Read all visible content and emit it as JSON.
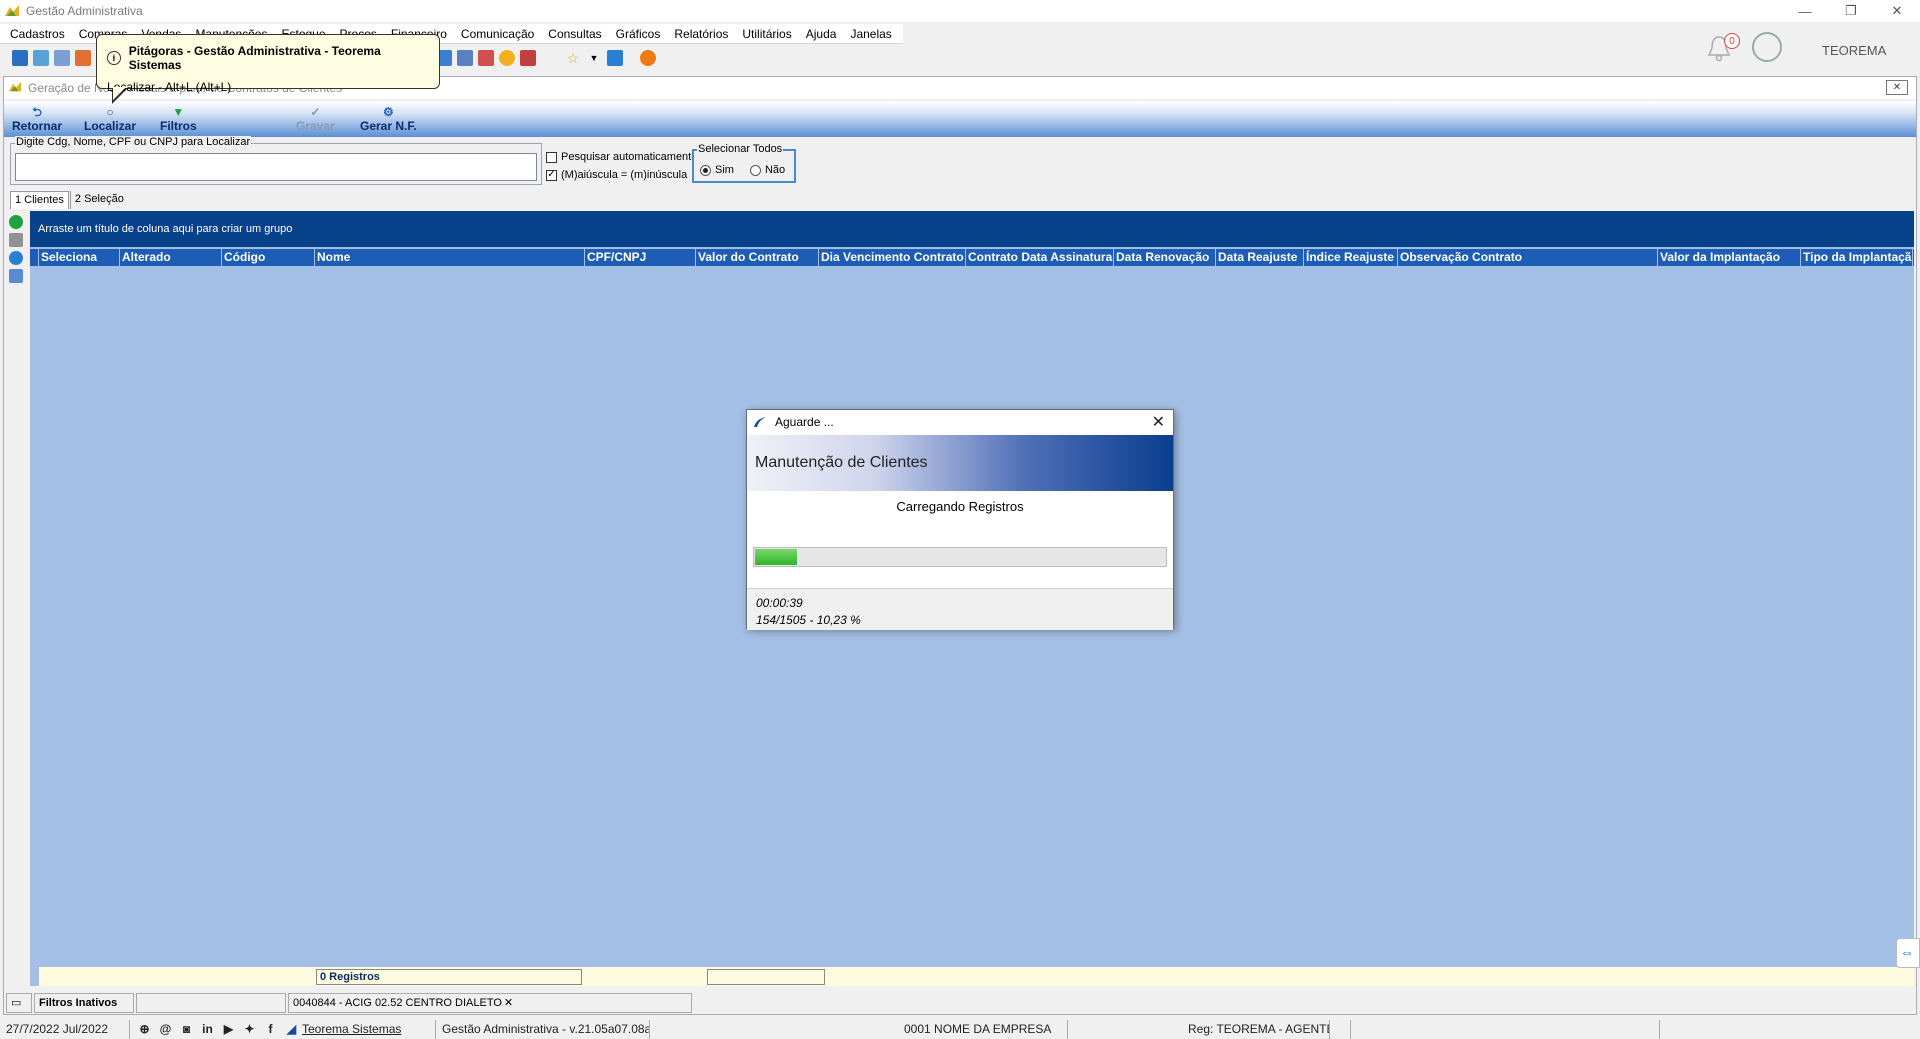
{
  "app": {
    "title": "Gestão Administrativa"
  },
  "menu": [
    "Cadastros",
    "Compras",
    "Vendas",
    "Manutenções",
    "Estoque",
    "Preços",
    "Financeiro",
    "Comunicação",
    "Consultas",
    "Gráficos",
    "Relatórios",
    "Utilitários",
    "Ajuda",
    "Janelas"
  ],
  "header": {
    "notification_count": "0",
    "user_name": "TEOREMA"
  },
  "tooltip": {
    "title": "Pitágoras - Gestão Administrativa - Teorema Sistemas",
    "body": "Localizar - Alt+L (Alt+L)"
  },
  "child": {
    "title": "Geração de Notas Fiscais a partir de Contratos de Clientes",
    "actions": {
      "retornar": "Retornar",
      "localizar": "Localizar",
      "filtros": "Filtros",
      "gravar": "Gravar",
      "gerar_nf": "Gerar N.F."
    },
    "search": {
      "legend": "Digite Cdg, Nome, CPF ou CNPJ para Localizar",
      "value": ""
    },
    "options": {
      "auto_search": "Pesquisar automaticamente",
      "case": "(M)aiúscula = (m)inúscula"
    },
    "select_all": {
      "legend": "Selecionar Todos",
      "yes": "Sim",
      "no": "Não"
    },
    "tabs": [
      "1 Clientes",
      "2 Seleção"
    ],
    "grid": {
      "group_hint": "Arraste um título de coluna aqui para criar um grupo",
      "columns": [
        "Seleciona",
        "Alterado",
        "Código",
        "Nome",
        "CPF/CNPJ",
        "Valor do Contrato",
        "Dia Vencimento Contrato",
        "Contrato Data Assinatura",
        "Data Renovação",
        "Data Reajuste",
        "Índice Reajuste",
        "Observação Contrato",
        "Valor da Implantação",
        "Tipo da Implantação"
      ],
      "footer_count": "0 Registros"
    },
    "status": {
      "filters": "Filtros Inativos",
      "info": "0040844 - ACIG 02.52 CENTRO DIALETO"
    }
  },
  "dialog": {
    "title": "Aguarde ...",
    "banner": "Manutenção de Clientes",
    "message": "Carregando Registros",
    "progress": 0.1023,
    "elapsed": "00:00:39",
    "counter": "154/1505 - 10,23 %"
  },
  "statusbar": {
    "date": "27/7/2022 Jul/2022",
    "company_link": "Teorema Sistemas",
    "version": "Gestão Administrativa - v.21.05a07.08a",
    "company": "0001 NOME DA EMPRESA",
    "reg": "Reg: TEOREMA - AGENTES"
  },
  "colors": {
    "accent": "#1d5db5",
    "grid_bg": "#a4bfe5",
    "group_bar": "#08428a",
    "progress": "#2fb52a"
  }
}
